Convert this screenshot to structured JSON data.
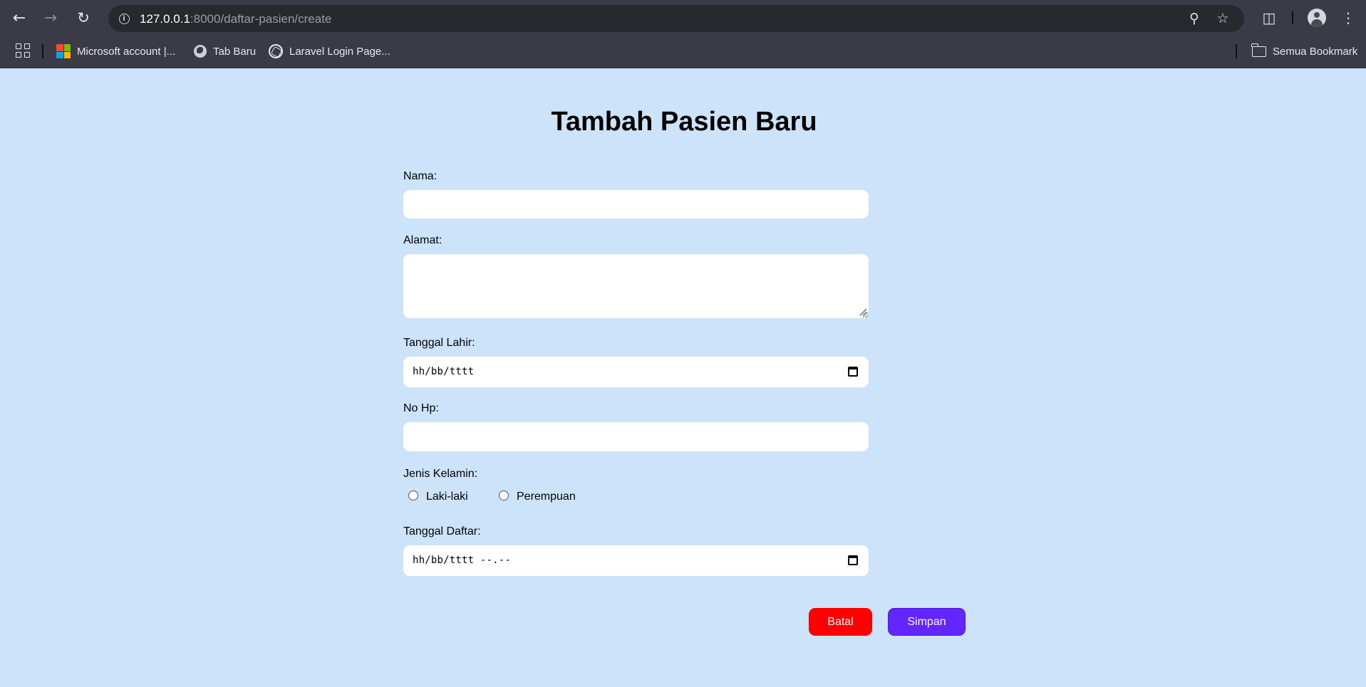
{
  "browser": {
    "url_host": "127.0.0.1",
    "url_path": ":8000/daftar-pasien/create",
    "icons": {
      "back": "back-arrow-icon",
      "forward": "forward-arrow-icon",
      "reload": "reload-icon",
      "site_info": "info-icon",
      "zoom": "zoom-icon",
      "bookmark_star": "star-icon",
      "extensions": "puzzle-icon",
      "profile": "avatar-icon",
      "menu": "kebab-menu-icon",
      "apps": "apps-grid-icon"
    },
    "bookmarks": [
      {
        "label": "Microsoft account |...",
        "icon": "microsoft-icon"
      },
      {
        "label": "Tab Baru",
        "icon": "globe-icon"
      },
      {
        "label": "Laravel Login Page...",
        "icon": "openai-icon"
      }
    ],
    "all_bookmarks_label": "Semua Bookmark"
  },
  "form": {
    "title": "Tambah Pasien Baru",
    "nama_label": "Nama:",
    "nama_value": "",
    "alamat_label": "Alamat:",
    "alamat_value": "",
    "tanggal_lahir_label": "Tanggal Lahir:",
    "tanggal_lahir_placeholder": "hh/bb/tttt",
    "no_hp_label": "No Hp:",
    "no_hp_value": "",
    "jenis_kelamin_label": "Jenis Kelamin:",
    "gender_options": [
      "Laki-laki",
      "Perempuan"
    ],
    "tanggal_daftar_label": "Tanggal Daftar:",
    "tanggal_daftar_placeholder": "hh/bb/tttt --.--",
    "batal_label": "Batal",
    "simpan_label": "Simpan"
  },
  "colors": {
    "page_background": "#cde3fa",
    "chrome_background": "#3b3b47",
    "batal_button": "#ff0000",
    "simpan_button": "#6326ff"
  }
}
